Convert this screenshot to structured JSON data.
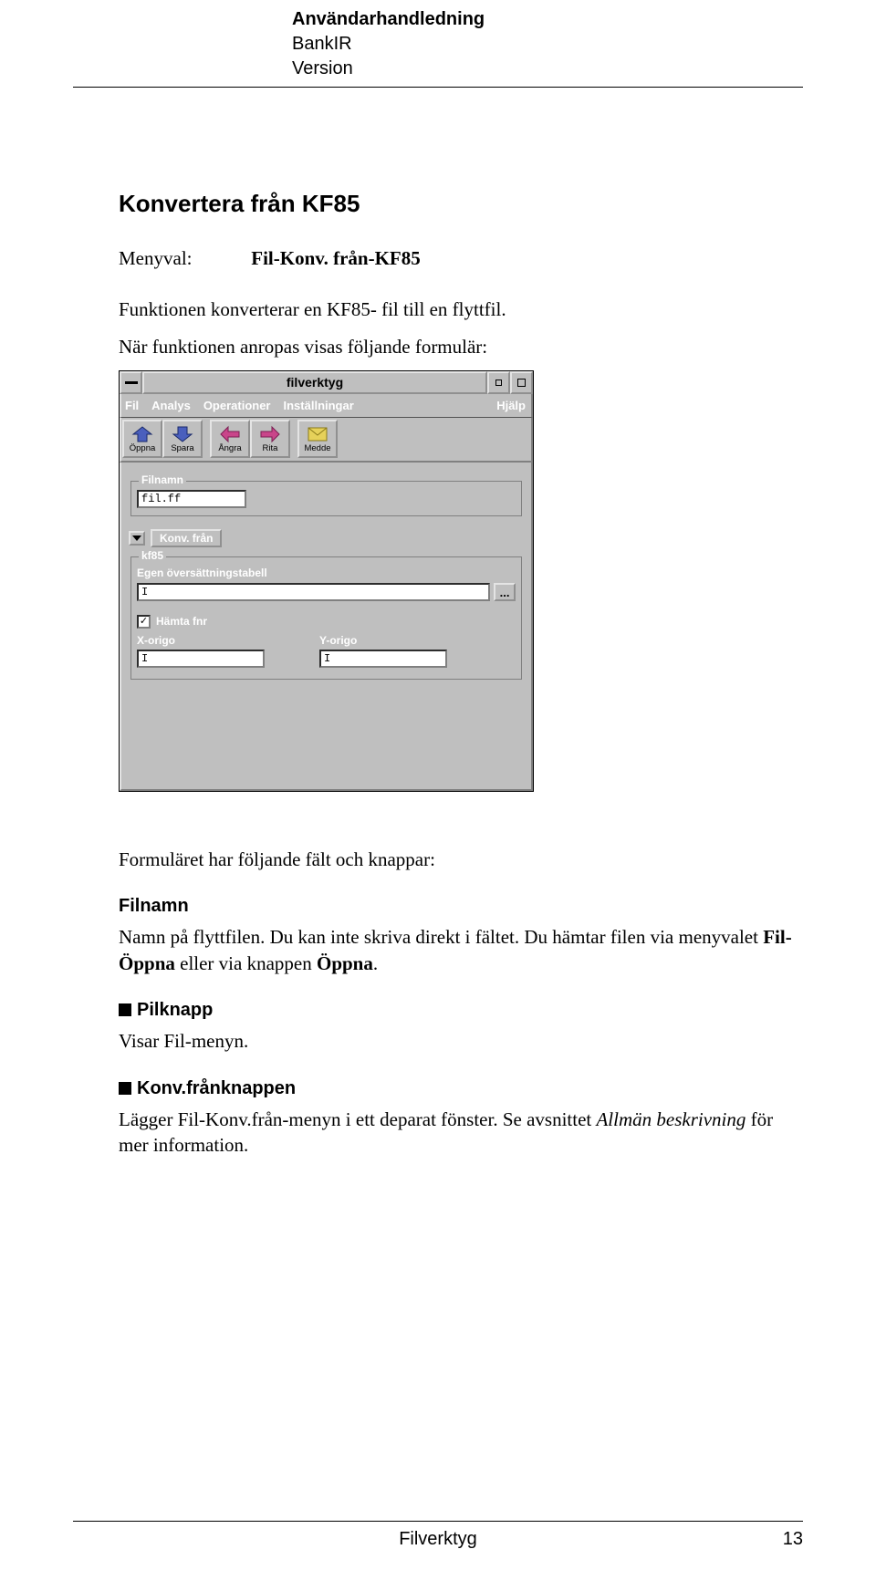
{
  "doc_header": {
    "line1": "Användarhandledning",
    "line2": "BankIR",
    "line3": "Version"
  },
  "section_title": "Konvertera från KF85",
  "menu_label": "Menyval:",
  "menu_value": "Fil-Konv. från-KF85",
  "intro_para": "Funktionen konverterar en KF85- fil till en flyttfil.",
  "intro_para_2": "När funktionen anropas visas följande formulär:",
  "window": {
    "title": "filverktyg",
    "menu": {
      "fil": "Fil",
      "analys": "Analys",
      "operationer": "Operationer",
      "installningar": "Inställningar",
      "hjalp": "Hjälp"
    },
    "toolbar": {
      "open": "Öppna",
      "save": "Spara",
      "undo": "Ångra",
      "draw": "Rita",
      "medde": "Medde"
    },
    "filnamn_legend": "Filnamn",
    "filnamn_value": "fil.ff",
    "konv_button": "Konv. från",
    "kf85_legend": "kf85",
    "egen_label": "Egen översättningstabell",
    "hamta_label": "Hämta fnr",
    "hamta_check": "✓",
    "x_origo": "X-origo",
    "y_origo": "Y-origo",
    "dots": "...",
    "cursor": "I"
  },
  "after_shot": "Formuläret har följande fält och knappar:",
  "field_filnamn_h": "Filnamn",
  "field_filnamn_p1": "Namn på flyttfilen. Du kan inte skriva direkt i fältet. Du hämtar filen via menyvalet ",
  "field_filnamn_b1": "Fil-Öppna",
  "field_filnamn_p2": " eller via knappen ",
  "field_filnamn_b2": "Öppna",
  "field_filnamn_p3": ".",
  "pilknapp_h": "Pilknapp",
  "pilknapp_p": "Visar Fil-menyn.",
  "konv_h": "Konv.frånknappen",
  "konv_p1": "Lägger Fil-Konv.från-menyn i ett deparat fönster. Se avsnittet ",
  "konv_i1": "Allmän beskrivning",
  "konv_p2": " för mer information.",
  "footer": {
    "center": "Filverktyg",
    "page": "13"
  }
}
